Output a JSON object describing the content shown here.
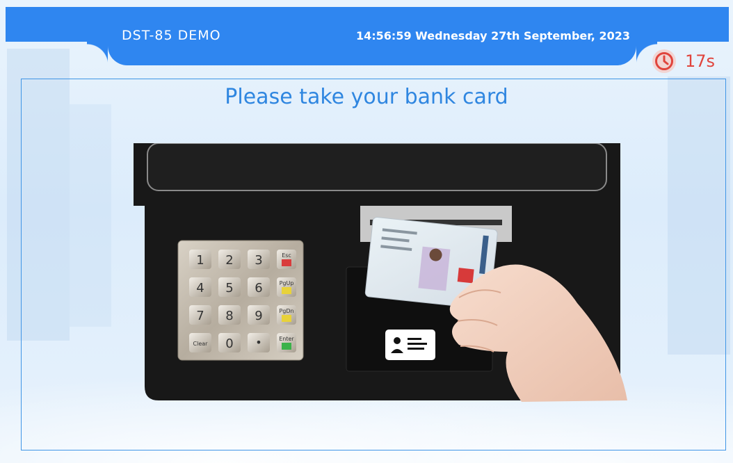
{
  "header": {
    "brand": "DST-85 DEMO",
    "datetime": "14:56:59 Wednesday 27th September, 2023"
  },
  "timer": {
    "icon": "clock-icon",
    "value": "17s"
  },
  "main": {
    "prompt": "Please take your bank card",
    "keypad_keys": [
      "1",
      "2",
      "3",
      "Esc",
      "4",
      "5",
      "6",
      "PgUp",
      "7",
      "8",
      "9",
      "PgDn",
      "Clear",
      "0",
      "•",
      "Enter"
    ]
  },
  "colors": {
    "header_blue": "#2f86f0",
    "prompt_blue": "#2f86e0",
    "timer_red": "#e0443c"
  }
}
